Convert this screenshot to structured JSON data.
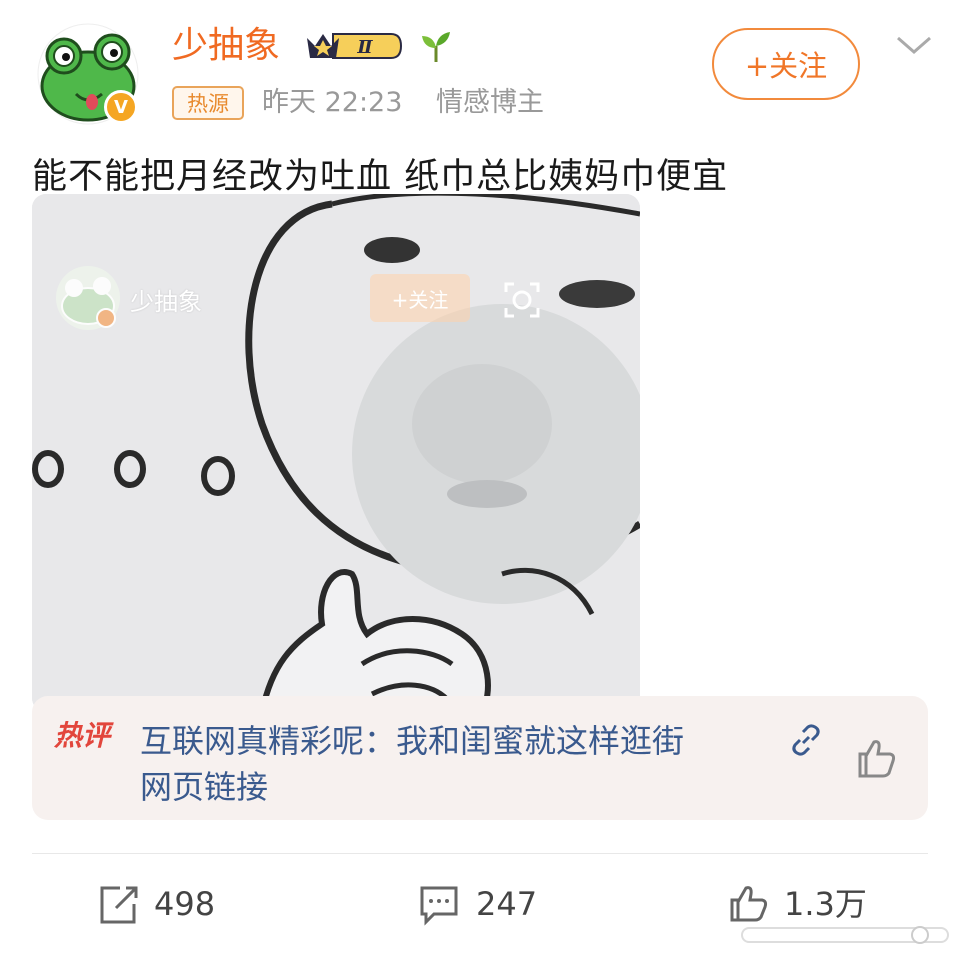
{
  "user": {
    "name": "少抽象",
    "level_badge": "Ⅱ",
    "hot_tag": "热源",
    "time": "昨天 22:23",
    "category": "情感博主",
    "follow_label": "+关注"
  },
  "post": {
    "text": "能不能把月经改为吐血 纸巾总比姨妈巾便宜"
  },
  "image_overlay": {
    "name": "少抽象",
    "follow_label": "+关注"
  },
  "hot_comment": {
    "label": "热评",
    "text": "互联网真精彩呢：我和闺蜜就这样逛街",
    "link_label": "网页链接"
  },
  "actions": {
    "reposts": "498",
    "comments": "247",
    "likes": "1.3万"
  },
  "colors": {
    "accent": "#f06a22",
    "link": "#3a5a8e",
    "hot": "#e2463c"
  }
}
